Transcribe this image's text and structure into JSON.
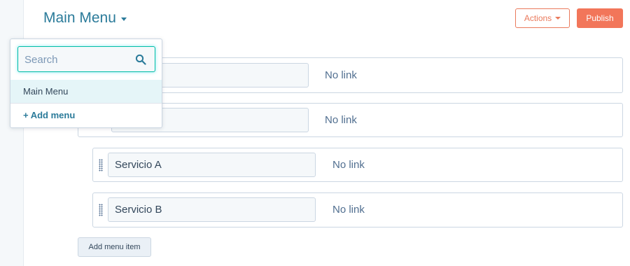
{
  "header": {
    "menu_title": "Main Menu",
    "actions_label": "Actions",
    "publish_label": "Publish"
  },
  "dropdown": {
    "search_placeholder": "Search",
    "search_value": "",
    "items": [
      {
        "label": "Main Menu",
        "selected": true
      }
    ],
    "add_menu_label": "+ Add menu"
  },
  "menu_items": [
    {
      "label": "",
      "link": "No link",
      "level": 0
    },
    {
      "label": "",
      "link": "No link",
      "level": 0
    },
    {
      "label": "Servicio A",
      "link": "No link",
      "level": 1
    },
    {
      "label": "Servicio B",
      "link": "No link",
      "level": 1
    }
  ],
  "add_menu_item_label": "Add menu item",
  "colors": {
    "accent": "#2b7b9a",
    "primary_button": "#f2765a",
    "secondary_border": "#ea7a5c",
    "focus_border": "#00bda5"
  },
  "icons": {
    "search": "search-icon",
    "drag": "drag-handle-icon",
    "caret": "caret-down-icon"
  }
}
